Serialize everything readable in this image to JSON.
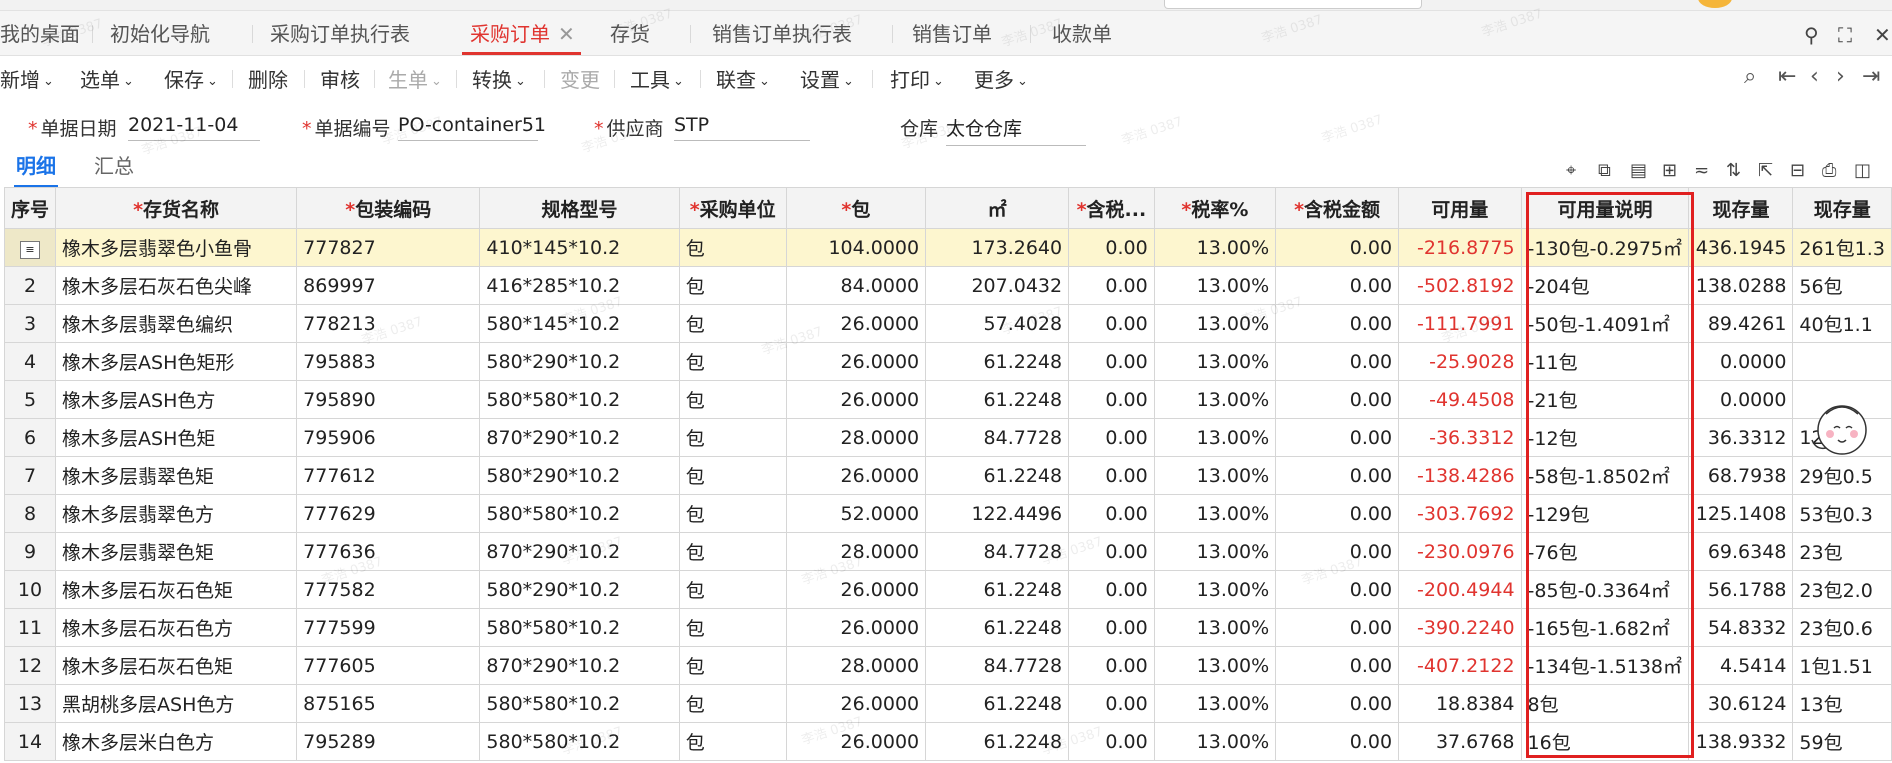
{
  "tabs": [
    {
      "label": "我的桌面",
      "active": false
    },
    {
      "label": "初始化导航",
      "active": false
    },
    {
      "label": "采购订单执行表",
      "active": false
    },
    {
      "label": "采购订单",
      "active": true
    },
    {
      "label": "存货",
      "active": false
    },
    {
      "label": "销售订单执行表",
      "active": false
    },
    {
      "label": "销售订单",
      "active": false
    },
    {
      "label": "收款单",
      "active": false
    }
  ],
  "toolbar": [
    {
      "label": "新增",
      "dropdown": true
    },
    {
      "label": "选单",
      "dropdown": true
    },
    {
      "label": "保存",
      "dropdown": true
    },
    {
      "label": "删除",
      "dropdown": false
    },
    {
      "label": "审核",
      "dropdown": false
    },
    {
      "label": "生单",
      "dropdown": true,
      "disabled": true
    },
    {
      "label": "转换",
      "dropdown": true
    },
    {
      "label": "变更",
      "dropdown": false,
      "disabled": true
    },
    {
      "label": "工具",
      "dropdown": true
    },
    {
      "label": "联查",
      "dropdown": true
    },
    {
      "label": "设置",
      "dropdown": true
    },
    {
      "label": "打印",
      "dropdown": true
    },
    {
      "label": "更多",
      "dropdown": true
    }
  ],
  "form": {
    "date_label": "单据日期",
    "date_value": "2021-11-04",
    "code_label": "单据编号",
    "code_value": "PO-container51",
    "supplier_label": "供应商",
    "supplier_value": "STP",
    "warehouse_label": "仓库",
    "warehouse_value": "太仓仓库"
  },
  "subtabs": {
    "detail": "明细",
    "summary": "汇总"
  },
  "columns": [
    {
      "label": "序号",
      "required": false
    },
    {
      "label": "存货名称",
      "required": true
    },
    {
      "label": "包装编码",
      "required": true
    },
    {
      "label": "规格型号",
      "required": false
    },
    {
      "label": "采购单位",
      "required": true
    },
    {
      "label": "包",
      "required": true
    },
    {
      "label": "㎡",
      "required": false
    },
    {
      "label": "含税...",
      "required": true
    },
    {
      "label": "税率%",
      "required": true
    },
    {
      "label": "含税金额",
      "required": true
    },
    {
      "label": "可用量",
      "required": false
    },
    {
      "label": "可用量说明",
      "required": false
    },
    {
      "label": "现存量",
      "required": false
    },
    {
      "label": "现存量",
      "required": false
    }
  ],
  "rows": [
    [
      "",
      "橡木多层翡翠色小鱼骨",
      "777827",
      "410*145*10.2",
      "包",
      "104.0000",
      "173.2640",
      "0.00",
      "13.00%",
      "0.00",
      "-216.8775",
      "-130包-0.2975㎡",
      "436.1945",
      "261包1.3"
    ],
    [
      "2",
      "橡木多层石灰石色尖峰",
      "869997",
      "416*285*10.2",
      "包",
      "84.0000",
      "207.0432",
      "0.00",
      "13.00%",
      "0.00",
      "-502.8192",
      "-204包",
      "138.0288",
      "56包"
    ],
    [
      "3",
      "橡木多层翡翠色编织",
      "778213",
      "580*145*10.2",
      "包",
      "26.0000",
      "57.4028",
      "0.00",
      "13.00%",
      "0.00",
      "-111.7991",
      "-50包-1.4091㎡",
      "89.4261",
      "40包1.1"
    ],
    [
      "4",
      "橡木多层ASH色矩形",
      "795883",
      "580*290*10.2",
      "包",
      "26.0000",
      "61.2248",
      "0.00",
      "13.00%",
      "0.00",
      "-25.9028",
      "-11包",
      "0.0000",
      ""
    ],
    [
      "5",
      "橡木多层ASH色方",
      "795890",
      "580*580*10.2",
      "包",
      "26.0000",
      "61.2248",
      "0.00",
      "13.00%",
      "0.00",
      "-49.4508",
      "-21包",
      "0.0000",
      ""
    ],
    [
      "6",
      "橡木多层ASH色矩",
      "795906",
      "870*290*10.2",
      "包",
      "28.0000",
      "84.7728",
      "0.00",
      "13.00%",
      "0.00",
      "-36.3312",
      "-12包",
      "36.3312",
      "12"
    ],
    [
      "7",
      "橡木多层翡翠色矩",
      "777612",
      "580*290*10.2",
      "包",
      "26.0000",
      "61.2248",
      "0.00",
      "13.00%",
      "0.00",
      "-138.4286",
      "-58包-1.8502㎡",
      "68.7938",
      "29包0.5"
    ],
    [
      "8",
      "橡木多层翡翠色方",
      "777629",
      "580*580*10.2",
      "包",
      "52.0000",
      "122.4496",
      "0.00",
      "13.00%",
      "0.00",
      "-303.7692",
      "-129包",
      "125.1408",
      "53包0.3"
    ],
    [
      "9",
      "橡木多层翡翠色矩",
      "777636",
      "870*290*10.2",
      "包",
      "28.0000",
      "84.7728",
      "0.00",
      "13.00%",
      "0.00",
      "-230.0976",
      "-76包",
      "69.6348",
      "23包"
    ],
    [
      "10",
      "橡木多层石灰石色矩",
      "777582",
      "580*290*10.2",
      "包",
      "26.0000",
      "61.2248",
      "0.00",
      "13.00%",
      "0.00",
      "-200.4944",
      "-85包-0.3364㎡",
      "56.1788",
      "23包2.0"
    ],
    [
      "11",
      "橡木多层石灰石色方",
      "777599",
      "580*580*10.2",
      "包",
      "26.0000",
      "61.2248",
      "0.00",
      "13.00%",
      "0.00",
      "-390.2240",
      "-165包-1.682㎡",
      "54.8332",
      "23包0.6"
    ],
    [
      "12",
      "橡木多层石灰石色矩",
      "777605",
      "870*290*10.2",
      "包",
      "28.0000",
      "84.7728",
      "0.00",
      "13.00%",
      "0.00",
      "-407.2122",
      "-134包-1.5138㎡",
      "4.5414",
      "1包1.51"
    ],
    [
      "13",
      "黑胡桃多层ASH色方",
      "875165",
      "580*580*10.2",
      "包",
      "26.0000",
      "61.2248",
      "0.00",
      "13.00%",
      "0.00",
      "18.8384",
      "8包",
      "30.6124",
      "13包"
    ],
    [
      "14",
      "橡木多层米白色方",
      "795289",
      "580*580*10.2",
      "包",
      "26.0000",
      "61.2248",
      "0.00",
      "13.00%",
      "0.00",
      "37.6768",
      "16包",
      "138.9332",
      "59包"
    ]
  ],
  "watermark": "李浩 0387",
  "colors": {
    "accent": "#e0342f",
    "highlight_border": "#e02020",
    "selected_row": "#fdf6cf",
    "link_blue": "#1a73e8"
  }
}
